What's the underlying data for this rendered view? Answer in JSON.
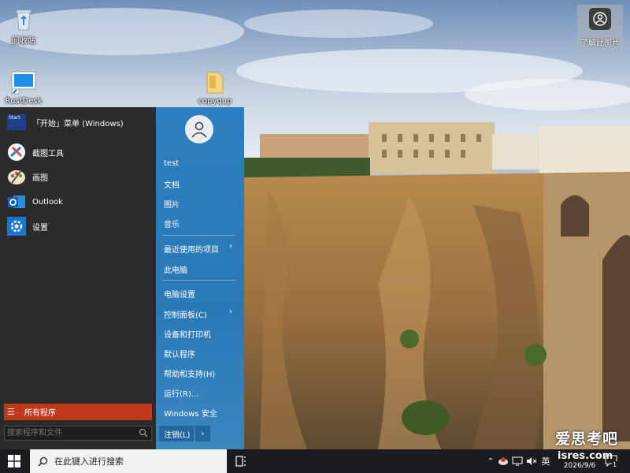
{
  "desktop": {
    "icons": [
      {
        "label": "回收站",
        "icon": "recycle-bin-icon"
      },
      {
        "label": "RustDesk",
        "icon": "rustdesk-icon"
      },
      {
        "label": "copyqup",
        "icon": "folder-icon"
      }
    ],
    "widget": {
      "label": "了解此图片",
      "icon": "camera-icon"
    },
    "watermark": {
      "line1": "爱思考吧",
      "line2": "isres.com"
    }
  },
  "start_menu": {
    "header": {
      "label": "「开始」菜单 (Windows)",
      "icon": "start-tile-icon",
      "tile_text": "Start"
    },
    "pinned": [
      {
        "label": "截图工具",
        "icon": "snipping-tool-icon"
      },
      {
        "label": "画图",
        "icon": "paint-icon"
      },
      {
        "label": "Outlook",
        "icon": "outlook-icon"
      },
      {
        "label": "设置",
        "icon": "settings-gear-icon"
      }
    ],
    "all_programs": "所有程序",
    "search_placeholder": "搜索程序和文件",
    "user": "test",
    "right_items": [
      {
        "label": "文档"
      },
      {
        "label": "图片"
      },
      {
        "label": "音乐"
      },
      {
        "label": "最近使用的项目",
        "submenu": true
      },
      {
        "label": "此电脑"
      },
      {
        "label": "电脑设置"
      },
      {
        "label": "控制面板(C)",
        "submenu": true
      },
      {
        "label": "设备和打印机"
      },
      {
        "label": "默认程序"
      },
      {
        "label": "帮助和支持(H)"
      },
      {
        "label": "运行(R)..."
      },
      {
        "label": "Windows 安全"
      }
    ],
    "logoff": "注销(L)",
    "logoff_arrow": "›",
    "chevron": "›"
  },
  "taskbar": {
    "search_text": "在此键入进行搜索",
    "ime": "英",
    "time": "isres.com",
    "date": "2026/9/6",
    "notification_count": "1",
    "accent": "#c0391b"
  }
}
